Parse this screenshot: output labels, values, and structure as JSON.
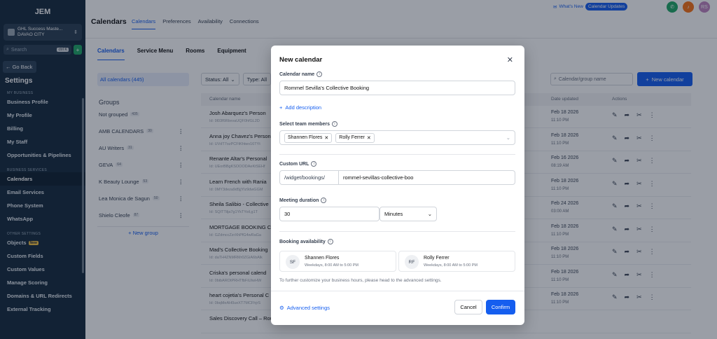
{
  "sidebar": {
    "logo_text": "JEM",
    "account_name": "GHL Success Maste...",
    "account_location": "DAVAO CITY",
    "search_placeholder": "Search",
    "search_shortcut": "ctrl K",
    "go_back": "Go Back",
    "settings_title": "Settings",
    "section_my_business": "MY BUSINESS",
    "my_business_items": [
      "Business Profile",
      "My Profile",
      "Billing",
      "My Staff",
      "Opportunities & Pipelines"
    ],
    "section_business_services": "BUSINESS SERVICES",
    "business_services_items": [
      "Calendars",
      "Email Services",
      "Phone System",
      "WhatsApp"
    ],
    "section_other_settings": "OTHER SETTINGS",
    "objects_label": "Objects",
    "new_badge": "New",
    "other_items": [
      "Custom Fields",
      "Custom Values",
      "Manage Scoring",
      "Domains & URL Redirects",
      "External Tracking"
    ]
  },
  "header": {
    "title": "Calendars",
    "tabs": [
      "Calendars",
      "Preferences",
      "Availability",
      "Connections"
    ],
    "whats_new": "What's New",
    "updates_pill": "Calendar Updates",
    "avatar_initials": "RS"
  },
  "subtabs": [
    "Calendars",
    "Service Menu",
    "Rooms",
    "Equipment"
  ],
  "groups": {
    "all_calendars": "All calendars (445)",
    "heading": "Groups",
    "items": [
      {
        "name": "Not grouped",
        "count": "435"
      },
      {
        "name": "AMB CALENDARS",
        "count": "30"
      },
      {
        "name": "AU Writers",
        "count": "31"
      },
      {
        "name": "GEVA",
        "count": "64"
      },
      {
        "name": "K Beauty Lounge",
        "count": "53"
      },
      {
        "name": "Lea Monica de Sagun",
        "count": "50"
      },
      {
        "name": "Shielo Cleofe",
        "count": "87"
      }
    ],
    "new_group": "New group"
  },
  "filters": {
    "status": "Status: All",
    "type": "Type: All"
  },
  "table_search_placeholder": "Calendar/group name",
  "new_calendar_button": "New calendar",
  "table": {
    "headers": [
      "Calendar name",
      "Date updated",
      "Actions"
    ],
    "rows": [
      {
        "name": "Josh Abarquez's Person",
        "id": "Id: 9l03f6RbvvaUQF0hfGL2D",
        "date": "Feb 18 2026",
        "time": "11:10 PM"
      },
      {
        "name": "Anna joy Chavez's Person",
        "id": "Id: UVdT7ozPCFtKhtwv16TYt",
        "date": "Feb 18 2026",
        "time": "11:10 PM"
      },
      {
        "name": "Renante Altar's Personal",
        "id": "Id: UEorBBgKSOOODAeKtSEHf",
        "date": "Feb 16 2026",
        "time": "08:19 AM"
      },
      {
        "name": "Learn French with Rania",
        "id": "Id: 0MY3deza9d5jjYlz9dwGGM",
        "date": "Feb 18 2026",
        "time": "11:10 PM"
      },
      {
        "name": "Sheila Salibio - Collective",
        "id": "Id: SQITTilja7g1YkTYoil,g1T",
        "date": "Feb 24 2026",
        "time": "03:00 AM"
      },
      {
        "name": "MORTGAGE BOOKING CA",
        "id": "Id: GZdmccZzrXhPfG4wRaGa",
        "date": "Feb 18 2026",
        "time": "11:10 PM"
      },
      {
        "name": "Mad's Collective Booking",
        "id": "Id: daTH4ZNMRMr0ZGiA6bAlk",
        "date": "Feb 18 2026",
        "time": "11:10 PM"
      },
      {
        "name": "Criska's personal calend",
        "id": "Id: 0bibAROtPRHTfbFiUIwHW",
        "date": "Feb 18 2026",
        "time": "11:10 PM"
      },
      {
        "name": "heart cojetia's Personal C",
        "id": "Id: 0bqMeAH0ueXT7MCFhjrS",
        "date": "Feb 18 2026",
        "time": "11:10 PM"
      },
      {
        "name": "Sales Discovery Call – Round Robin",
        "id": "",
        "date": "",
        "time": ""
      }
    ]
  },
  "modal": {
    "title": "New calendar",
    "calendar_name_label": "Calendar name",
    "calendar_name_value": "Rommel Sevilla's Collective Booking",
    "add_description": "Add description",
    "team_members_label": "Select team members",
    "team_members": [
      "Shannen Flores",
      "Rolly Ferrer"
    ],
    "custom_url_label": "Custom URL",
    "url_prefix": "/widget/bookings/",
    "url_slug": "rommel-sevillas-collective-boo",
    "meeting_duration_label": "Meeting duration",
    "duration_value": "30",
    "duration_unit": "Minutes",
    "booking_availability_label": "Booking availability",
    "availability": [
      {
        "initials": "SF",
        "name": "Shannen Flores",
        "hours": "Weekdays, 8:00 AM to 5:00 PM"
      },
      {
        "initials": "RF",
        "name": "Rolly Ferrer",
        "hours": "Weekdays, 8:00 AM to 5:00 PM"
      }
    ],
    "hint": "To further customize your business hours, please head to the advanced settings.",
    "advanced_settings": "Advanced settings",
    "cancel": "Cancel",
    "confirm": "Confirm"
  },
  "colors": {
    "primary": "#155eef",
    "sidebar": "#152a3d",
    "overlay": "rgba(15,23,42,0.42)"
  }
}
